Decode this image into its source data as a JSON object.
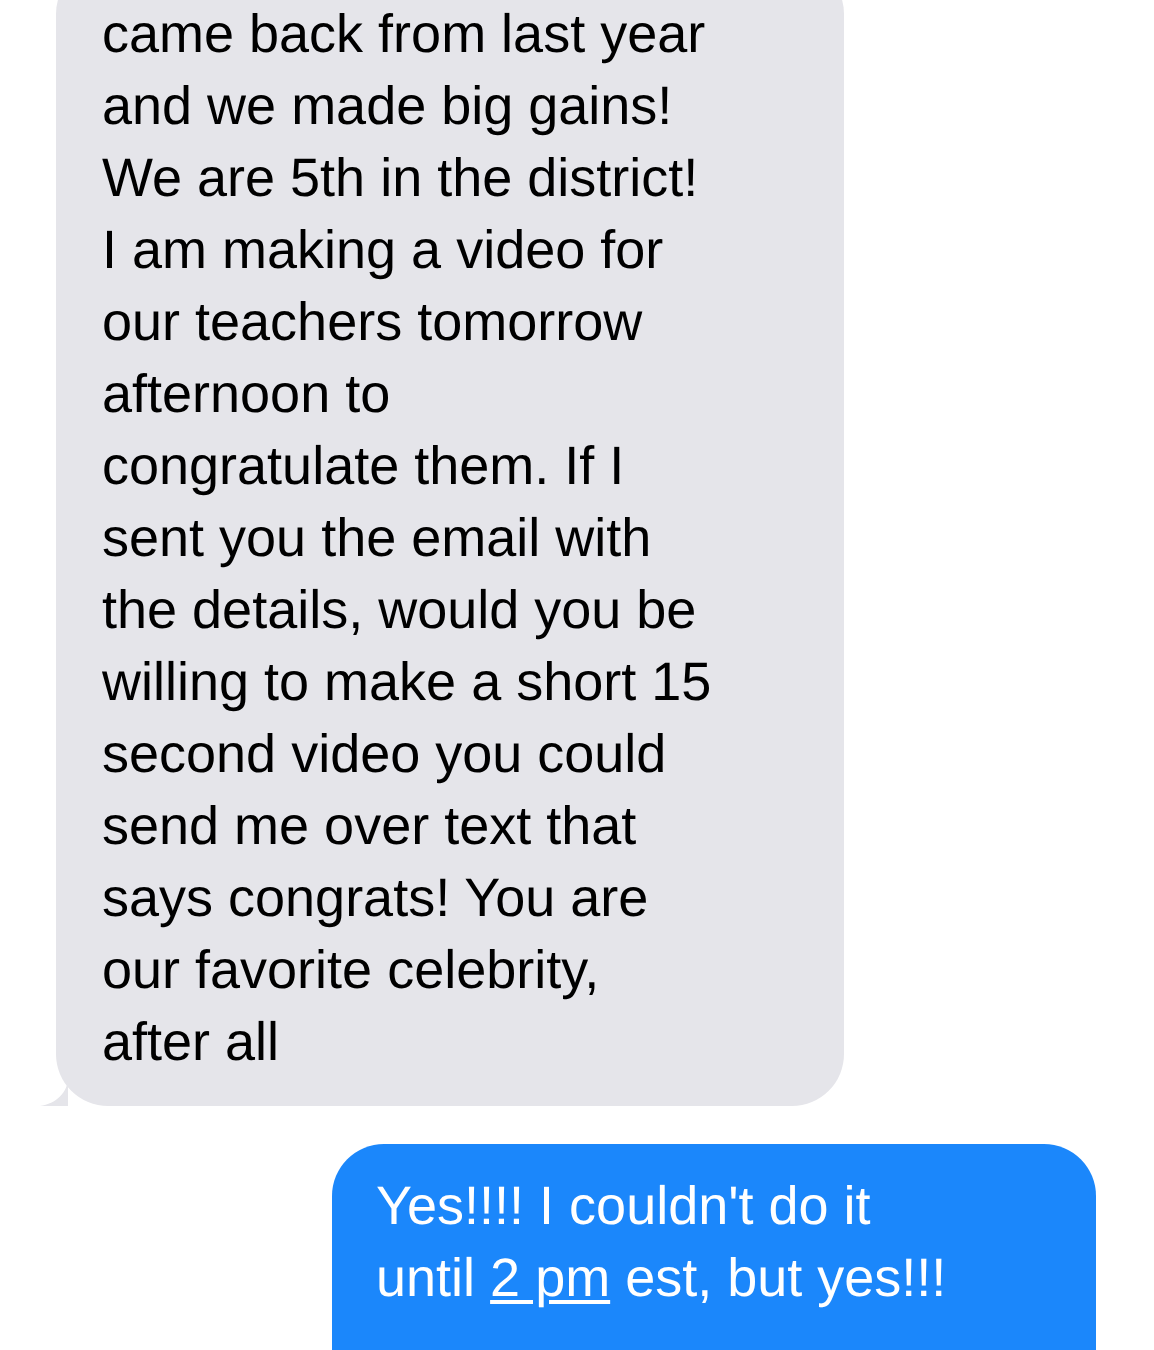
{
  "messages": [
    {
      "outgoing": false,
      "parts": [
        {
          "kind": "text",
          "text": "came back from last year\nand we made big gains!\nWe are 5th in the district!\nI am making a video for\nour teachers tomorrow\nafternoon to\ncongratulate them. If I\nsent you the email with\nthe details, would you be\nwilling to make a short 15\nsecond video you could\nsend me over text that\nsays congrats! You are\nour favorite celebrity,\nafter all"
        }
      ]
    },
    {
      "outgoing": true,
      "parts": [
        {
          "kind": "text",
          "text": "Yes!!!! I couldn't do it\nuntil "
        },
        {
          "kind": "link",
          "text": "2 pm"
        },
        {
          "kind": "text",
          "text": " est, but yes!!!"
        }
      ]
    }
  ]
}
